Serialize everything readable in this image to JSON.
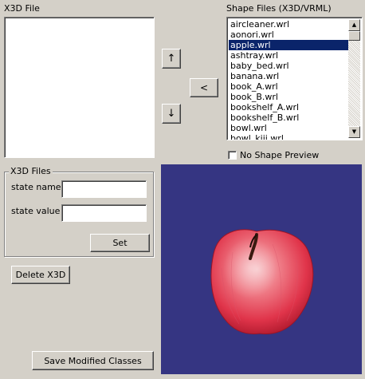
{
  "x3d_file": {
    "label": "X3D File"
  },
  "shape_files": {
    "label": "Shape Files (X3D/VRML)",
    "items": [
      "aircleaner.wrl",
      "aonori.wrl",
      "apple.wrl",
      "ashtray.wrl",
      "baby_bed.wrl",
      "banana.wrl",
      "book_A.wrl",
      "book_B.wrl",
      "bookshelf_A.wrl",
      "bookshelf_B.wrl",
      "bowl.wrl",
      "bowl_kiji.wrl"
    ],
    "selected_index": 2,
    "no_preview_label": "No Shape Preview",
    "no_preview_checked": false
  },
  "arrows": {
    "up": "↑",
    "down": "↓",
    "add": "<"
  },
  "x3d_files_group": {
    "title": "X3D Files",
    "state_name_label": "state name",
    "state_name_value": "",
    "state_value_label": "state value",
    "state_value_value": "",
    "set_button": "Set"
  },
  "buttons": {
    "delete_x3d": "Delete X3D",
    "save_modified": "Save Modified Classes"
  },
  "preview": {
    "background": "#353582",
    "object": "apple"
  },
  "colors": {
    "window_bg": "#d4d0c8",
    "selection": "#0a246a"
  }
}
